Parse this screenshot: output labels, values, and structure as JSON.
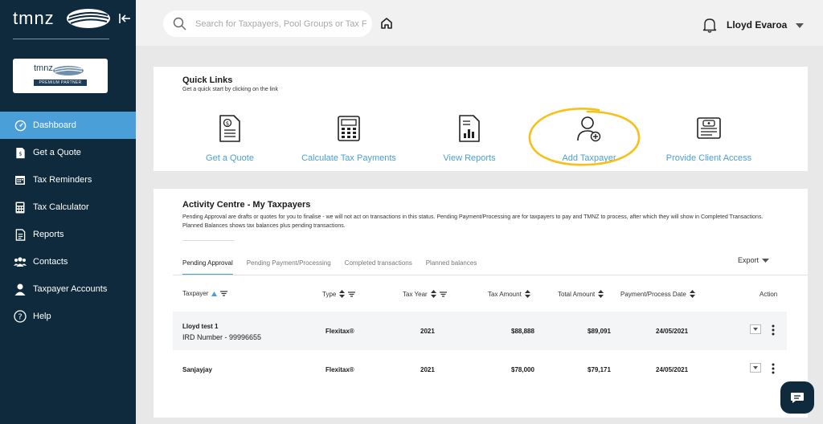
{
  "brand": {
    "name": "tmnz",
    "partner_name": "tmnz",
    "partner_tag": "PREMIUM PARTNER"
  },
  "sidebar": {
    "items": [
      {
        "label": "Dashboard",
        "icon": "dashboard-icon",
        "active": true
      },
      {
        "label": "Get a Quote",
        "icon": "quote-icon"
      },
      {
        "label": "Tax Reminders",
        "icon": "calendar-icon"
      },
      {
        "label": "Tax Calculator",
        "icon": "calculator-icon"
      },
      {
        "label": "Reports",
        "icon": "report-icon"
      },
      {
        "label": "Contacts",
        "icon": "contacts-icon"
      },
      {
        "label": "Taxpayer Accounts",
        "icon": "user-icon"
      },
      {
        "label": "Help",
        "icon": "help-icon"
      }
    ]
  },
  "header": {
    "search_placeholder": "Search for Taxpayers, Pool Groups or Tax F",
    "user_name": "Lloyd Evaroa"
  },
  "quick_links": {
    "title": "Quick Links",
    "subtitle": "Get a quick start by clicking on the link",
    "items": [
      {
        "label": "Get a Quote",
        "icon": "quote-document-icon"
      },
      {
        "label": "Calculate Tax Payments",
        "icon": "calculator-icon"
      },
      {
        "label": "View Reports",
        "icon": "report-chart-icon"
      },
      {
        "label": "Add Taxpayer",
        "icon": "add-user-icon"
      },
      {
        "label": "Provide Client Access",
        "icon": "client-access-icon"
      }
    ],
    "highlight_color": "#f5c11a"
  },
  "activity": {
    "title": "Activity Centre - My Taxpayers",
    "description": "Pending Approval are drafts or quotes for you to finalise - we will not act on transactions in this status. Pending Payment/Processing are for taxpayers to pay and TMNZ to process, after which they will show in Completed Transactions. Planned Balances shows tax balances plus pending transactions.",
    "tabs": [
      "Pending Approval",
      "Pending Payment/Processing",
      "Completed transactions",
      "Planned balances"
    ],
    "export_label": "Export",
    "columns": [
      "Taxpayer",
      "Type",
      "Tax Year",
      "Tax Amount",
      "Total Amount",
      "Payment/Process Date",
      "Action"
    ],
    "rows": [
      {
        "taxpayer": "Lloyd test 1",
        "ird": "IRD Number - 99996655",
        "type": "Flexitax®",
        "year": "2021",
        "tax": "$88,888",
        "total": "$89,091",
        "date": "24/05/2021"
      },
      {
        "taxpayer": "Sanjayjay",
        "ird": "",
        "type": "Flexitax®",
        "year": "2021",
        "tax": "$78,000",
        "total": "$79,171",
        "date": "24/05/2021"
      }
    ]
  },
  "colors": {
    "sidebar": "#0f2a3d",
    "accent": "#4a9fd8",
    "highlight": "#f5c11a"
  }
}
